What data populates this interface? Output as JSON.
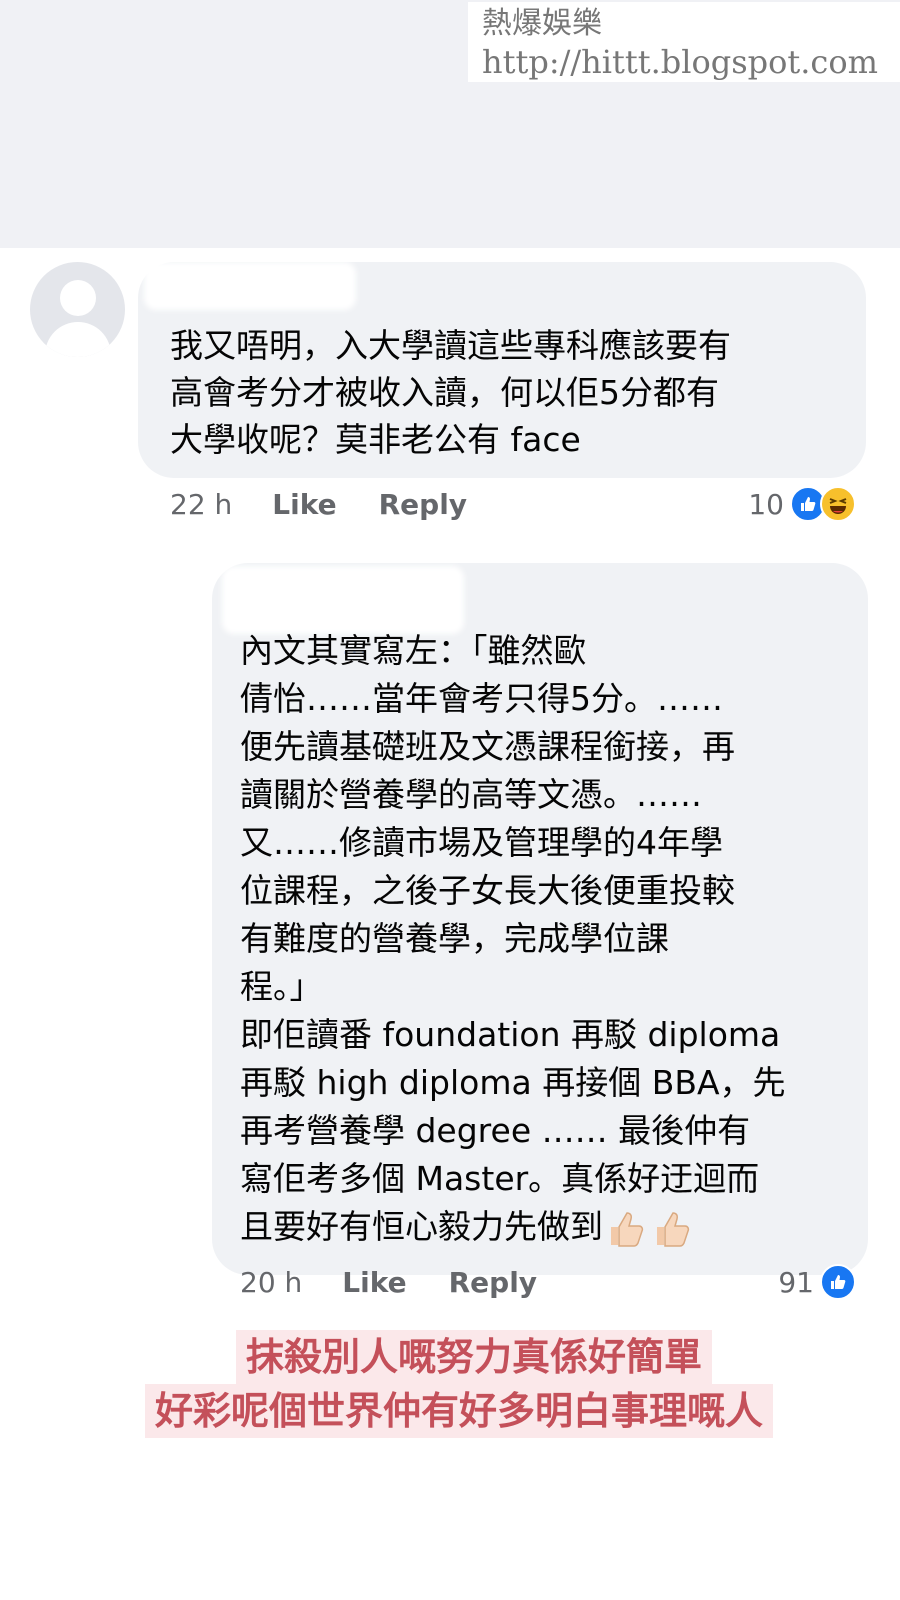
{
  "watermark": {
    "site_name": "熱爆娛樂",
    "url": "http://hittt.blogspot.com"
  },
  "comments": [
    {
      "text": "我又唔明，入大學讀這些專科應該要有\n高會考分才被收入讀，何以佢5分都有\n大學收呢？莫非老公有 face",
      "time": "22 h",
      "like_label": "Like",
      "reply_label": "Reply",
      "reaction_count": "10",
      "reactions": [
        "like-icon",
        "haha-icon"
      ]
    },
    {
      "name_fragment": "...",
      "text": "內文其實寫左：「雖然歐\n倩怡……當年會考只得5分。……\n便先讀基礎班及文憑課程銜接，再\n讀關於營養學的高等文憑。……\n又……修讀市場及管理學的4年學\n位課程，之後子女長大後便重投較\n有難度的營養學，完成學位課\n程。」\n即佢讀番 foundation 再駁 diploma\n再駁 high diploma 再接個 BBA，先\n再考營養學 degree …… 最後仲有\n寫佢考多個 Master。真係好迂迴而\n且要好有恒心毅力先做到",
      "emoji": [
        "thumbs-up-light-icon",
        "thumbs-up-light-icon"
      ],
      "time": "20 h",
      "like_label": "Like",
      "reply_label": "Reply",
      "reaction_count": "91",
      "reactions": [
        "like-icon"
      ]
    }
  ],
  "captions": {
    "line1": "抹殺別人嘅努力真係好簡單",
    "line2": "好彩呢個世界仲有好多明白事理嘅人"
  },
  "colors": {
    "bubble": "#f0f2f5",
    "meta_text": "#65676b",
    "like_blue": "#1877f2",
    "caption_text": "#c4505a",
    "caption_bg": "#fbe8ea"
  }
}
